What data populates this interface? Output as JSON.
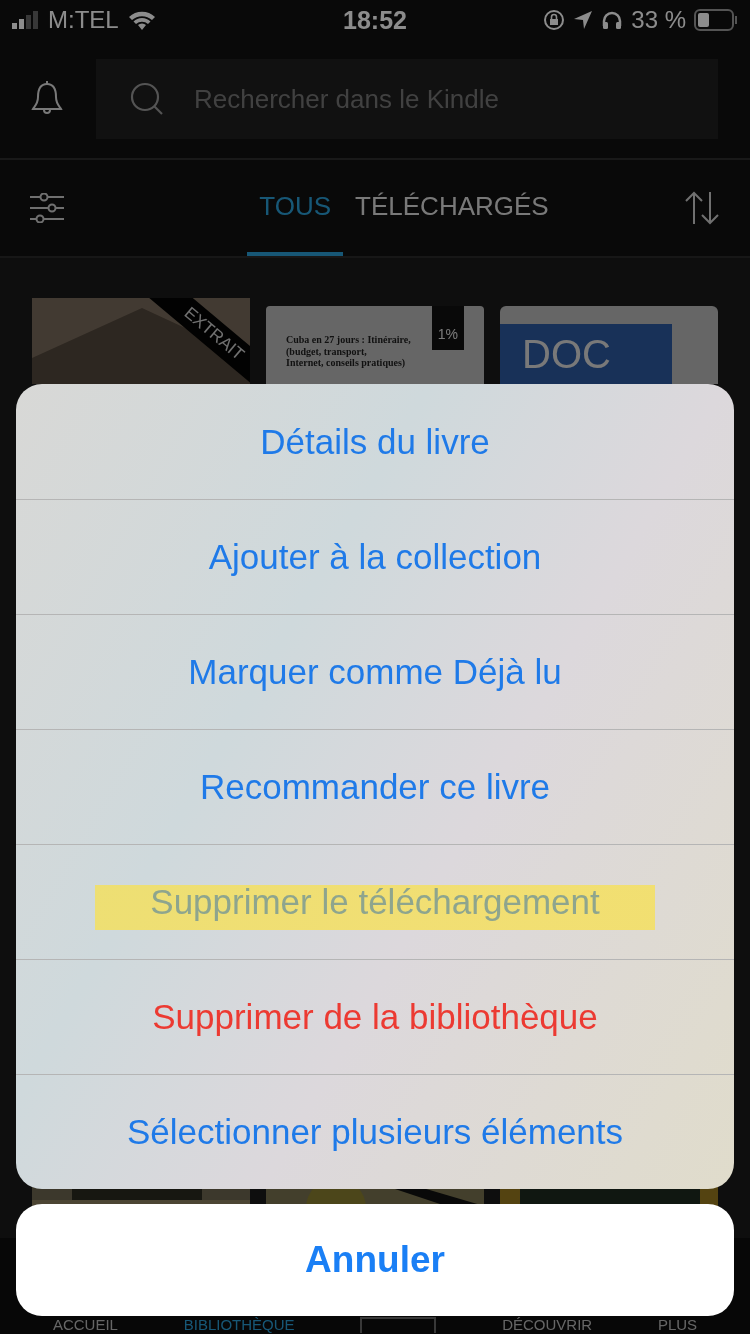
{
  "status_bar": {
    "carrier": "M:TEL",
    "time": "18:52",
    "battery": "33 %"
  },
  "search": {
    "placeholder": "Rechercher dans le Kindle"
  },
  "tabs": [
    {
      "label": "TOUS",
      "selected": true
    },
    {
      "label": "TÉLÉCHARGÉS",
      "selected": false
    }
  ],
  "books": [
    {
      "kind": "picture",
      "ribbon": "EXTRAIT"
    },
    {
      "kind": "document",
      "badge": "1%",
      "lines": [
        "Cuba en 27 jours : Itinéraire,",
        "(budget, transport,",
        "Internet, conseils pratiques)"
      ]
    },
    {
      "kind": "doc",
      "label": "DOC"
    }
  ],
  "action_sheet": {
    "actions": [
      {
        "label": "Détails du livre",
        "kind": "default",
        "highlighted": false
      },
      {
        "label": "Ajouter à la collection",
        "kind": "default",
        "highlighted": false
      },
      {
        "label": "Marquer comme Déjà lu",
        "kind": "default",
        "highlighted": false
      },
      {
        "label": "Recommander ce livre",
        "kind": "default",
        "highlighted": false
      },
      {
        "label": "Supprimer le téléchargement",
        "kind": "default",
        "highlighted": true
      },
      {
        "label": "Supprimer de la bibliothèque",
        "kind": "destructive",
        "highlighted": false
      },
      {
        "label": "Sélectionner plusieurs éléments",
        "kind": "default",
        "highlighted": false
      }
    ],
    "cancel": "Annuler"
  },
  "bottom_nav": [
    {
      "label": "ACCUEIL",
      "selected": false
    },
    {
      "label": "BIBLIOTHÈQUE",
      "selected": true
    },
    {
      "label": "DÉCOUVRIR",
      "selected": false
    },
    {
      "label": "PLUS",
      "selected": false
    }
  ]
}
